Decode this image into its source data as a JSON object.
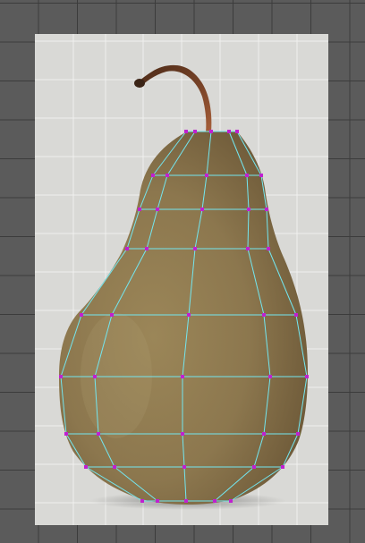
{
  "editor": {
    "mode": "mesh-warp",
    "grid_color": "#2f2f2f",
    "mesh_line_color": "#73e6f0",
    "mesh_point_color": "#c020d0",
    "canvas_background": "#5b5b5b",
    "artboard_background": "#d9d9d6"
  },
  "subject": {
    "name": "pear",
    "body_color": "#8e7a52",
    "stem_color": "#6a3a22"
  }
}
